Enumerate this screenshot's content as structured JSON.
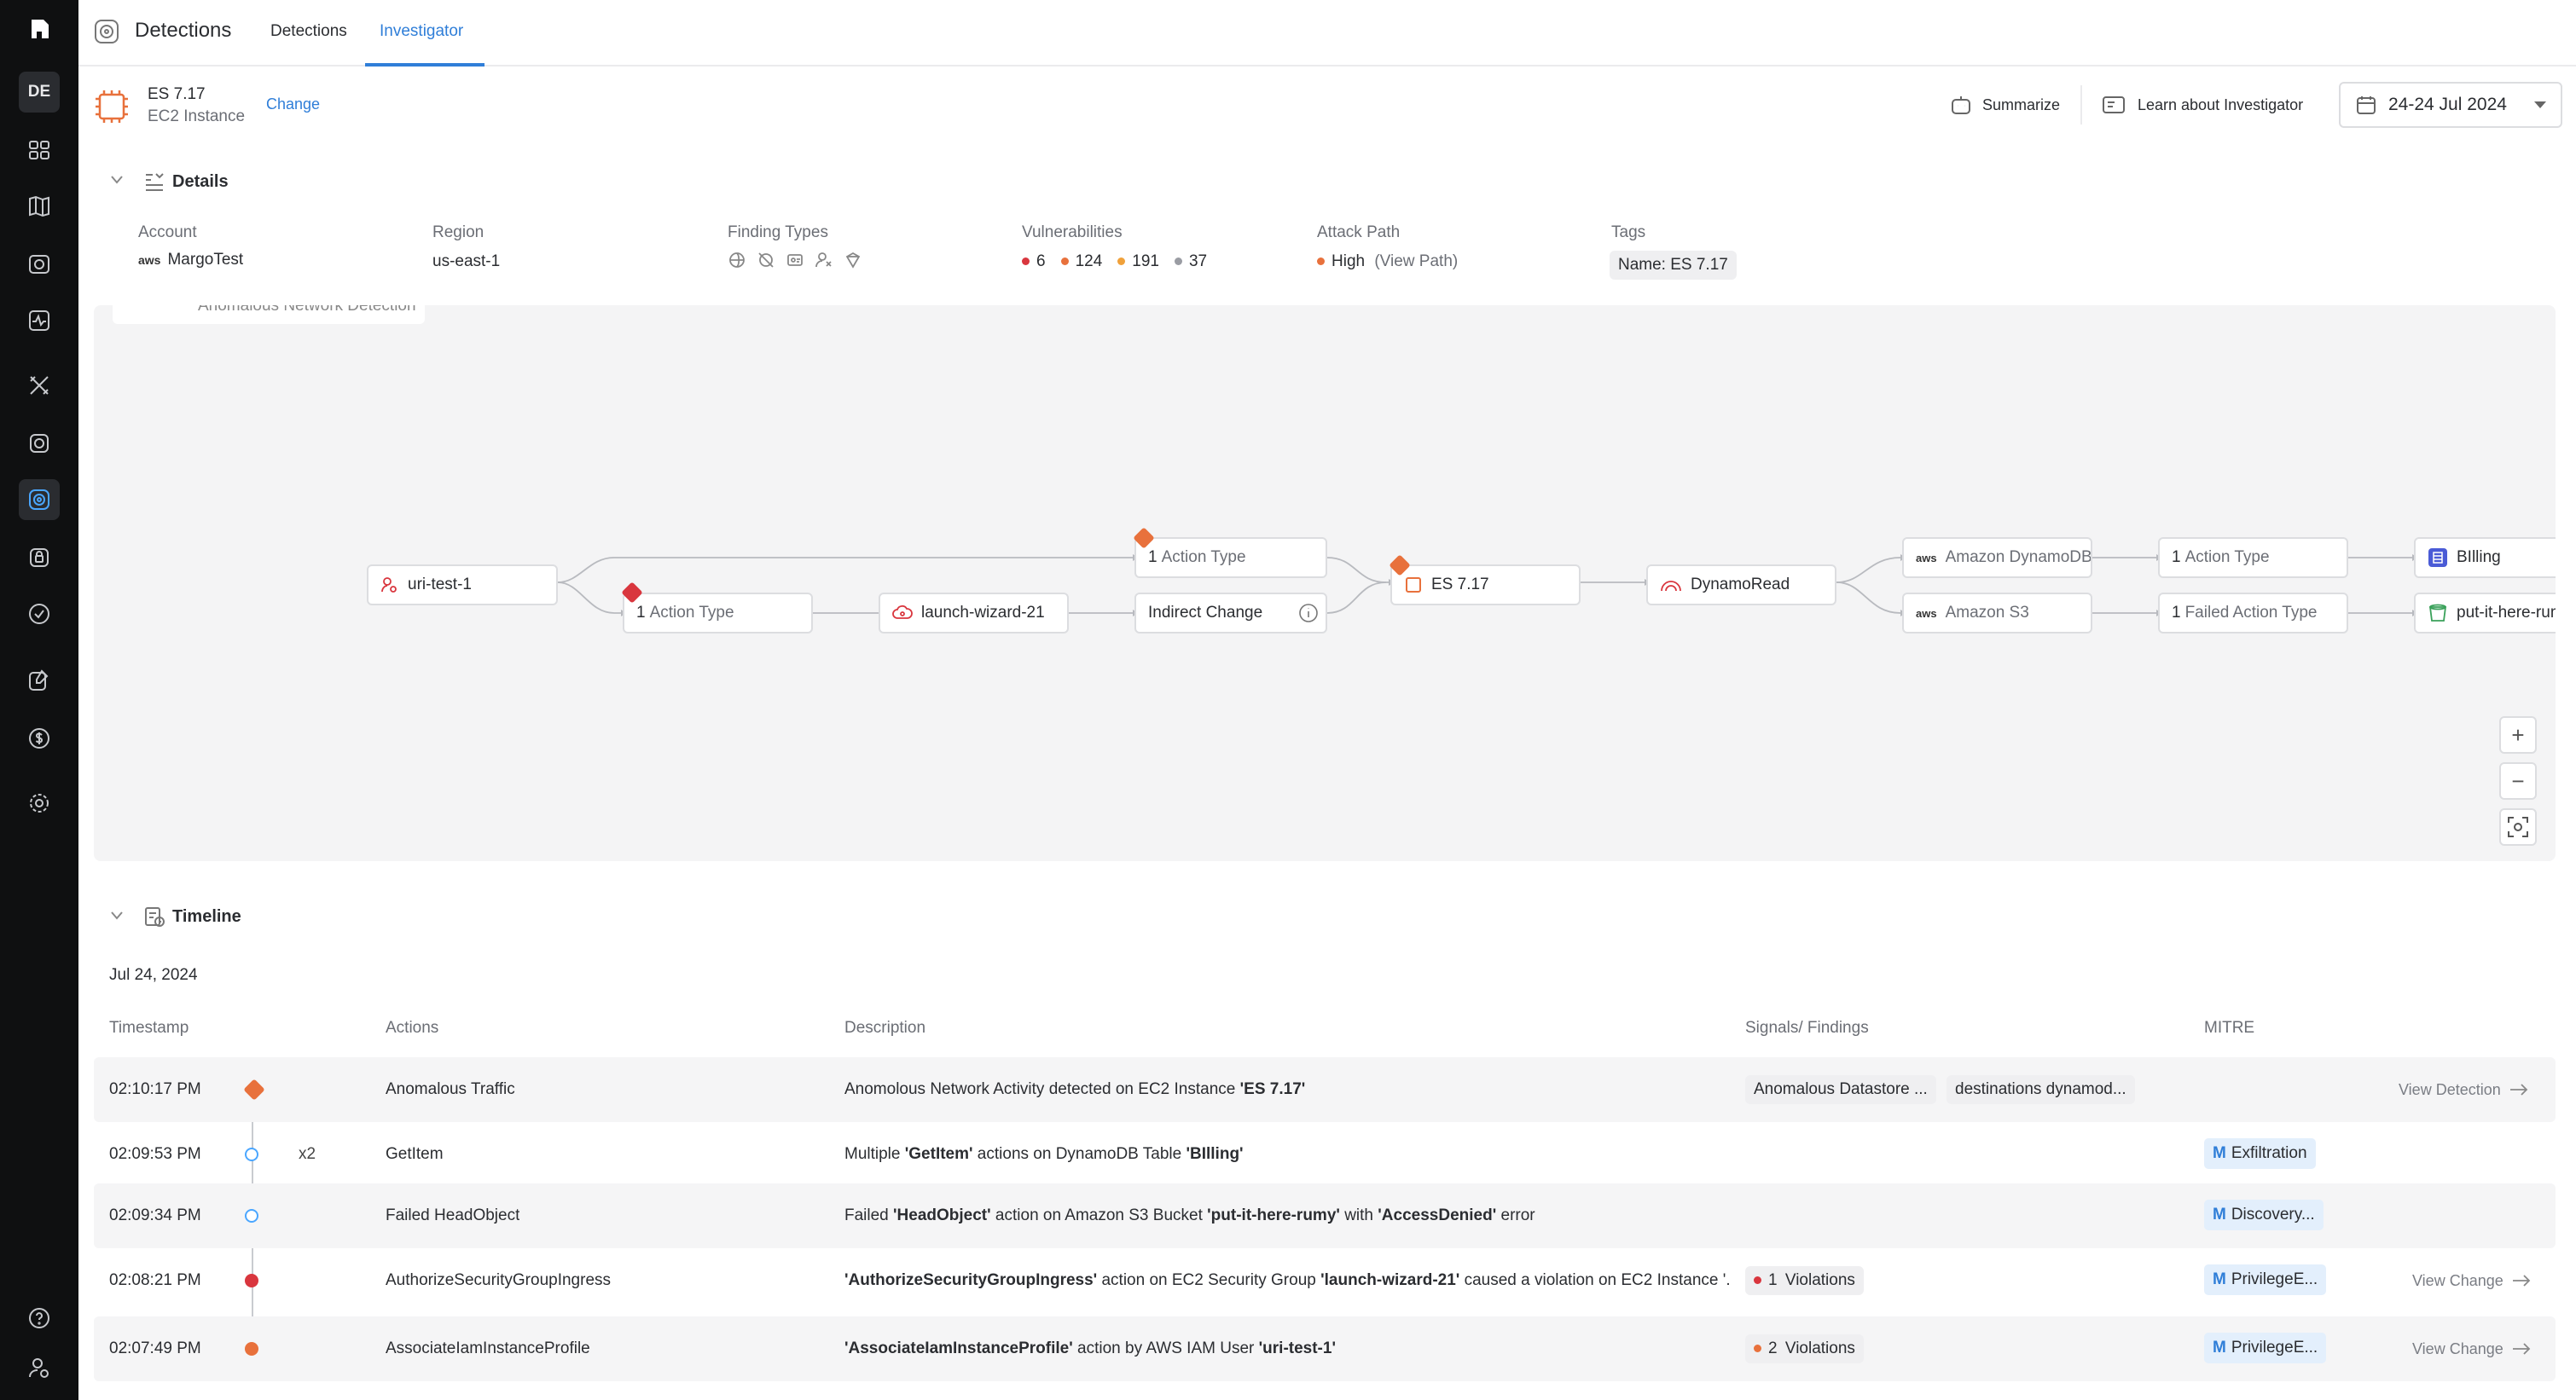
{
  "sidebar": {
    "avatar": "DE"
  },
  "header": {
    "title": "Detections",
    "tabs": [
      {
        "label": "Detections"
      },
      {
        "label": "Investigator"
      }
    ]
  },
  "asset": {
    "name": "ES 7.17",
    "type": "EC2 Instance",
    "change_label": "Change"
  },
  "actions": {
    "summarize": "Summarize",
    "learn": "Learn about Investigator",
    "date_range": "24-24 Jul 2024"
  },
  "details": {
    "title": "Details",
    "account": {
      "label": "Account",
      "value": "MargoTest",
      "logo": "aws"
    },
    "region": {
      "label": "Region",
      "value": "us-east-1"
    },
    "finding_types": {
      "label": "Finding Types"
    },
    "vulnerabilities": {
      "label": "Vulnerabilities",
      "critical": "6",
      "high": "124",
      "medium": "191",
      "low": "37"
    },
    "attack_path": {
      "label": "Attack Path",
      "level": "High",
      "view": "(View Path)"
    },
    "tags": {
      "label": "Tags",
      "value": "Name: ES 7.17"
    }
  },
  "graph": {
    "partial_label": "Anomalous Network Detection",
    "nodes": {
      "uri": "uri-test-1",
      "action1_count": "1",
      "action1_text": "Action Type",
      "action2_count": "1",
      "action2_text": "Action Type",
      "launch": "launch-wizard-21",
      "indirect": "Indirect Change",
      "es": "ES 7.17",
      "dynamoread": "DynamoRead",
      "dynamodb": "Amazon DynamoDB",
      "s3": "Amazon S3",
      "action3_count": "1",
      "action3_text": "Action Type",
      "failed_count": "1",
      "failed_text": "Failed Action Type",
      "billing": "BIlling",
      "bucket": "put-it-here-rumy",
      "aws": "aws"
    },
    "zoom_in": "+",
    "zoom_out": "−"
  },
  "timeline": {
    "title": "Timeline",
    "date": "Jul 24, 2024",
    "headers": {
      "timestamp": "Timestamp",
      "actions": "Actions",
      "description": "Description",
      "signals": "Signals/ Findings",
      "mitre": "MITRE"
    },
    "rows": [
      {
        "time": "02:10:17 PM",
        "action": "Anomalous Traffic",
        "d1": "Anomolous Network Activity detected on EC2 Instance ",
        "d2": "'ES 7.17'",
        "signal1": "Anomalous Datastore ...",
        "signal2": "destinations dynamod...",
        "link": "View Detection"
      },
      {
        "time": "02:09:53 PM",
        "count": "x2",
        "action": "GetItem",
        "d1": "Multiple ",
        "d2": "'GetItem'",
        "d3": " actions on DynamoDB Table ",
        "d4": "'BIlling'",
        "mitre": "Exfiltration"
      },
      {
        "time": "02:09:34 PM",
        "action": "Failed HeadObject",
        "d1": "Failed ",
        "d2": "'HeadObject'",
        "d3": " action on Amazon S3 Bucket ",
        "d4": "'put-it-here-rumy'",
        "d5": " with ",
        "d6": "'AccessDenied'",
        "d7": " error",
        "mitre": "Discovery..."
      },
      {
        "time": "02:08:21 PM",
        "action": "AuthorizeSecurityGroupIngress",
        "d1": "'AuthorizeSecurityGroupIngress'",
        "d2": " action on EC2 Security Group ",
        "d3": "'launch-wizard-21'",
        "d4": " caused a violation on EC2 Instance '...",
        "violations_count": "1",
        "violations": "Violations",
        "mitre": "PrivilegeE...",
        "link": "View Change"
      },
      {
        "time": "02:07:49 PM",
        "action": "AssociateIamInstanceProfile",
        "d1": "'AssociateIamInstanceProfile'",
        "d2": " action by AWS IAM User ",
        "d3": "'uri-test-1'",
        "violations_count": "2",
        "violations": "Violations",
        "mitre": "PrivilegeE...",
        "link": "View Change"
      }
    ]
  },
  "colors": {
    "accent": "#2f7ed8",
    "critical": "#d9363e",
    "high": "#e8713c",
    "medium": "#f0a13a",
    "low": "#9a9ca3"
  }
}
